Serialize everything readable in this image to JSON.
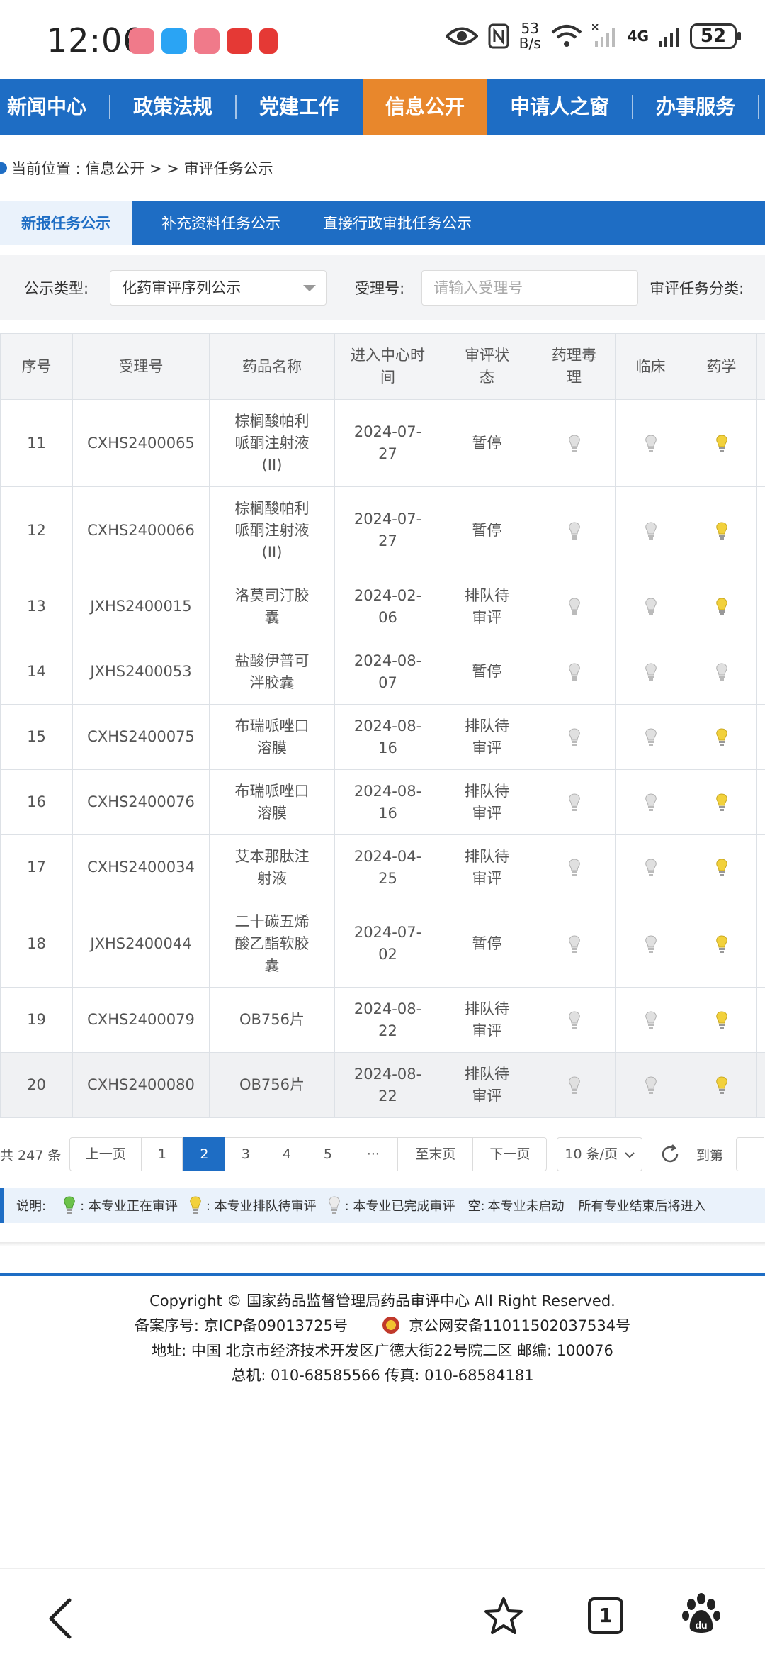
{
  "status_bar": {
    "time": "12:06",
    "net_speed_value": "53",
    "net_speed_unit": "B/s",
    "network_type": "4G",
    "battery": "52"
  },
  "nav": {
    "items": [
      {
        "label": "新闻中心"
      },
      {
        "label": "政策法规"
      },
      {
        "label": "党建工作"
      },
      {
        "label": "信息公开"
      },
      {
        "label": "申请人之窗"
      },
      {
        "label": "办事服务"
      }
    ],
    "active_index": 3
  },
  "breadcrumb": {
    "text": "当前位置 : 信息公开 > > 审评任务公示"
  },
  "sub_tabs": [
    {
      "label": "新报任务公示"
    },
    {
      "label": "补充资料任务公示"
    },
    {
      "label": "直接行政审批任务公示"
    }
  ],
  "filter": {
    "type_label": "公示类型:",
    "type_value": "化药审评序列公示",
    "accept_label": "受理号:",
    "accept_placeholder": "请输入受理号",
    "category_label": "审评任务分类:"
  },
  "table": {
    "headers": [
      "序号",
      "受理号",
      "药品名称",
      "进入中心时间",
      "审评状态",
      "药理毒理",
      "临床",
      "药学"
    ],
    "rows": [
      {
        "no": "11",
        "accept": "CXHS2400065",
        "drug": "棕榈酸帕利哌酮注射液(II)",
        "date": "2024-07-27",
        "status": "暂停",
        "pharm_tox": "completed",
        "clinical": "completed",
        "pharmacy": "queued"
      },
      {
        "no": "12",
        "accept": "CXHS2400066",
        "drug": "棕榈酸帕利哌酮注射液(II)",
        "date": "2024-07-27",
        "status": "暂停",
        "pharm_tox": "completed",
        "clinical": "completed",
        "pharmacy": "queued"
      },
      {
        "no": "13",
        "accept": "JXHS2400015",
        "drug": "洛莫司汀胶囊",
        "date": "2024-02-06",
        "status": "排队待审评",
        "pharm_tox": "completed",
        "clinical": "completed",
        "pharmacy": "queued"
      },
      {
        "no": "14",
        "accept": "JXHS2400053",
        "drug": "盐酸伊普可泮胶囊",
        "date": "2024-08-07",
        "status": "暂停",
        "pharm_tox": "completed",
        "clinical": "completed",
        "pharmacy": "completed"
      },
      {
        "no": "15",
        "accept": "CXHS2400075",
        "drug": "布瑞哌唑口溶膜",
        "date": "2024-08-16",
        "status": "排队待审评",
        "pharm_tox": "completed",
        "clinical": "completed",
        "pharmacy": "queued"
      },
      {
        "no": "16",
        "accept": "CXHS2400076",
        "drug": "布瑞哌唑口溶膜",
        "date": "2024-08-16",
        "status": "排队待审评",
        "pharm_tox": "completed",
        "clinical": "completed",
        "pharmacy": "queued"
      },
      {
        "no": "17",
        "accept": "CXHS2400034",
        "drug": "艾本那肽注射液",
        "date": "2024-04-25",
        "status": "排队待审评",
        "pharm_tox": "completed",
        "clinical": "completed",
        "pharmacy": "queued"
      },
      {
        "no": "18",
        "accept": "JXHS2400044",
        "drug": "二十碳五烯酸乙酯软胶囊",
        "date": "2024-07-02",
        "status": "暂停",
        "pharm_tox": "completed",
        "clinical": "completed",
        "pharmacy": "queued"
      },
      {
        "no": "19",
        "accept": "CXHS2400079",
        "drug": "OB756片",
        "date": "2024-08-22",
        "status": "排队待审评",
        "pharm_tox": "completed",
        "clinical": "completed",
        "pharmacy": "queued"
      },
      {
        "no": "20",
        "accept": "CXHS2400080",
        "drug": "OB756片",
        "date": "2024-08-22",
        "status": "排队待审评",
        "pharm_tox": "completed",
        "clinical": "completed",
        "pharmacy": "queued"
      }
    ]
  },
  "pagination": {
    "total": "共 247 条",
    "prev": "上一页",
    "pages": [
      "1",
      "2",
      "3",
      "4",
      "5",
      "···"
    ],
    "current": "2",
    "last": "至末页",
    "next": "下一页",
    "page_size": "10 条/页",
    "goto": "到第"
  },
  "legend": {
    "title": "说明:",
    "in_review": "本专业正在审评",
    "queued": "本专业排队待审评",
    "completed": "本专业已完成审评",
    "not_started_prefix": "空:",
    "not_started": "本专业未启动",
    "note": "所有专业结束后将进入"
  },
  "footer": {
    "copyright": "Copyright © 国家药品监督管理局药品审评中心   All Right Reserved.",
    "icp": "备案序号:  京ICP备09013725号",
    "police": "京公网安备11011502037534号",
    "address": "地址:  中国 北京市经济技术开发区广德大街22号院二区      邮编:  100076",
    "phone": "总机:  010-68585566      传真:  010-68584181"
  },
  "bottom_bar": {
    "tab_count": "1"
  },
  "colors": {
    "primary": "#1e6dc4",
    "active_tab": "#e8872c",
    "bulb_queued": "#f2d13c",
    "bulb_in_review": "#6cc24a",
    "bulb_completed": "#e0e0e0"
  }
}
